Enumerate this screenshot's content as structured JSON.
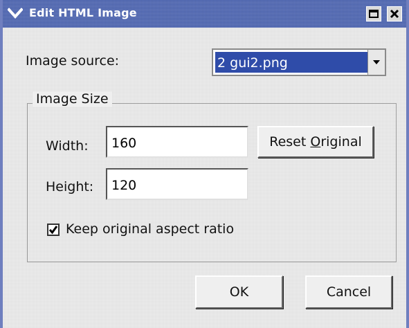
{
  "window": {
    "title": "Edit HTML Image"
  },
  "image_source": {
    "label": "Image source:",
    "selected": "2 gui2.png"
  },
  "image_size": {
    "group_title": "Image Size",
    "width_label": "Width:",
    "width_value": "160",
    "height_label": "Height:",
    "height_value": "120",
    "reset_pre": "Reset ",
    "reset_underlined": "O",
    "reset_post": "riginal",
    "keep_aspect_label": "Keep original aspect ratio",
    "keep_aspect_checked": true
  },
  "buttons": {
    "ok": "OK",
    "cancel": "Cancel"
  },
  "colors": {
    "titlebar": "#4a63b2",
    "selection": "#2f4ca9",
    "dialog_bg": "#efefef"
  }
}
